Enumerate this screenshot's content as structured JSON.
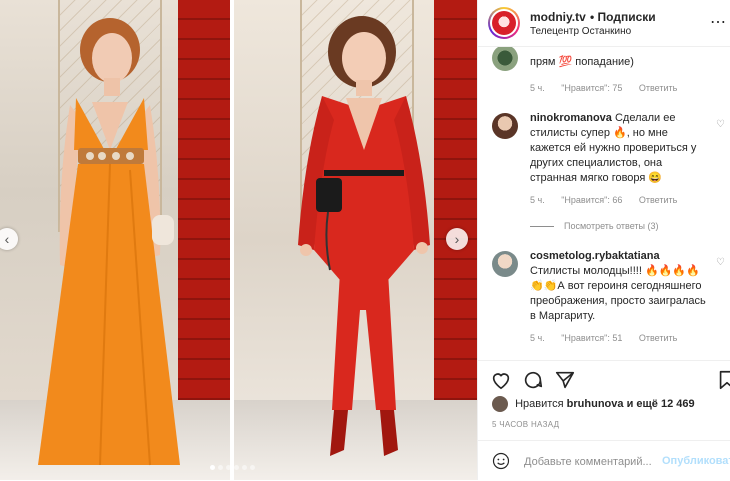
{
  "post": {
    "username": "modniy.tv",
    "separator": "•",
    "follow_label": "Подписки",
    "location": "Телецентр Останкино",
    "more_icon": "more-options-icon"
  },
  "comments": [
    {
      "username": "",
      "text": "прям 💯 попадание)",
      "time": "5 ч.",
      "likes": "\"Нравится\": 75",
      "reply": "Ответить"
    },
    {
      "username": "ninokromanova",
      "text": "Сделали ее стилисты супер 🔥, но мне кажется ей нужно провериться у других специалистов, она странная мягко говоря 😄",
      "time": "5 ч.",
      "likes": "\"Нравится\": 66",
      "reply": "Ответить",
      "view_replies": "Посмотреть ответы (3)"
    },
    {
      "username": "cosmetolog.rybaktatiana",
      "text": "Стилисты молодцы!!!! 🔥🔥🔥🔥 👏👏А вот героиня сегодняшнего преображения, просто заигралась в Маргариту.",
      "time": "5 ч.",
      "likes": "\"Нравится\": 51",
      "reply": "Ответить"
    }
  ],
  "likes_line": {
    "prefix": "Нравится",
    "user": "bruhunova",
    "suffix": "и ещё 12 469"
  },
  "timestamp": "5 ЧАСОВ НАЗАД",
  "comment_box": {
    "placeholder": "Добавьте комментарий...",
    "publish_label": "Опубликовать"
  },
  "carousel": {
    "prev_arrow": "‹",
    "next_arrow": "›",
    "slides_count": 6,
    "active_index": 0
  },
  "colors": {
    "link_blue": "#b2dffc",
    "text": "#262626",
    "muted": "#8e8e8e",
    "orange_dress": "#f28a1c",
    "red_suit": "#d9281e"
  }
}
